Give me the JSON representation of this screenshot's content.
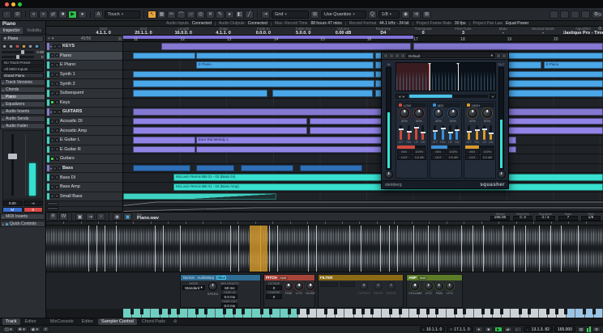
{
  "colors": {
    "accent_green": "#2fbf4e",
    "record_red": "#d84848",
    "tool_highlight": "#e8a33d",
    "clip_blue": "#4aa7e8",
    "clip_blue_dark": "#2f6fb8",
    "clip_purple": "#9184e6",
    "folder_purple": "#8478d2",
    "clip_cyan": "#38e0cf",
    "clip_teal": "#3ed2c2",
    "cycle_purple": "#8071d8",
    "band_low": "#cf4a3c",
    "band_mid": "#3f8fd6",
    "band_high": "#d89a2c",
    "selection_orange": "#d69a28",
    "meter_cyan": "#35e0d0"
  },
  "toolbar": {
    "transport": [
      {
        "icon": "rewind",
        "glyph": "«"
      },
      {
        "icon": "forward",
        "glyph": "»"
      },
      {
        "icon": "cycle",
        "glyph": "⇄"
      },
      {
        "icon": "stop",
        "glyph": "■"
      },
      {
        "icon": "play",
        "glyph": "▶",
        "active": true
      },
      {
        "icon": "record",
        "glyph": "●"
      }
    ],
    "automation_mode": "Touch",
    "tools": [
      {
        "name": "object-selection",
        "glyph": "↖",
        "active": true
      },
      {
        "name": "range",
        "glyph": "▦"
      },
      {
        "name": "split",
        "glyph": "✂"
      },
      {
        "name": "glue",
        "glyph": "⌒"
      },
      {
        "name": "erase",
        "glyph": "▱"
      },
      {
        "name": "zoom",
        "glyph": "◎"
      },
      {
        "name": "mute",
        "glyph": "✕"
      },
      {
        "name": "draw",
        "glyph": "✎"
      },
      {
        "name": "play-tool",
        "glyph": "▸"
      },
      {
        "name": "color",
        "glyph": "◧"
      },
      {
        "name": "line",
        "glyph": "╱"
      }
    ],
    "snap_label": "Grid",
    "quantize_label": "Use Quantize",
    "quantize_value": "1/8"
  },
  "status_line": {
    "items": [
      {
        "label": "Audio Inputs",
        "value": "Connected"
      },
      {
        "label": "Audio Outputs",
        "value": "Connected"
      },
      {
        "label": "Max. Record Time",
        "value": "88 hours 47 mins"
      },
      {
        "label": "Record Format",
        "value": "44.1 kHz - 24 bit"
      },
      {
        "label": "Project Frame Rate",
        "value": "30 fps"
      },
      {
        "label": "Project Pan Law",
        "value": "Equal Power"
      }
    ]
  },
  "info_line": {
    "fields": [
      {
        "label": "Start",
        "value": "4.1.1. 0"
      },
      {
        "label": "End",
        "value": "20.1.1. 0"
      },
      {
        "label": "Length",
        "value": "16.0.0. 0"
      },
      {
        "label": "Snap",
        "value": "4.1.1. 0"
      },
      {
        "label": "Fade-In",
        "value": "0.0.0. 0"
      },
      {
        "label": "Fade-Out",
        "value": "5.0.0. 0"
      },
      {
        "label": "Volume",
        "value": "0.00 dB"
      },
      {
        "label": "Root Key",
        "value": "D4"
      },
      {
        "label": "Transpose",
        "value": "0"
      },
      {
        "label": "Fine-Tune",
        "value": "3"
      },
      {
        "label": "Mute",
        "value": "-"
      },
      {
        "label": "Musical Mode",
        "value": "-"
      },
      {
        "label": "Algorithm",
        "value": "Elastique Pro - Time"
      }
    ]
  },
  "inspector": {
    "track_name": "Piano",
    "tabs": [
      {
        "label": "Inspector",
        "active": true
      },
      {
        "label": "Visibility",
        "active": false
      }
    ],
    "slot_label": "Piano",
    "volume_value": "0.00",
    "pan_value": "C",
    "routing_rows": [
      "No Track Preset",
      "All MIDI Inputs",
      "Grand Piano"
    ],
    "sections": [
      {
        "label": "Track Versions"
      },
      {
        "label": "Chords"
      },
      {
        "label": "Piano",
        "active": true
      },
      {
        "label": "Equalizers"
      },
      {
        "label": "Audio Inserts"
      },
      {
        "label": "Audio Sends"
      },
      {
        "label": "Audio Fader",
        "open": true
      }
    ],
    "fader_value": "0.00",
    "fader_peak": "-∞",
    "mute_label": "M",
    "solo_label": "S",
    "lower_sections": [
      "MIDI Inserts",
      "Quick Controls"
    ]
  },
  "track_list_header": {
    "counter": "45/56"
  },
  "tracks": [
    {
      "name": "KEYS",
      "type": "folder",
      "clips": [
        {
          "l": 8,
          "w": 52,
          "c": "folder"
        },
        {
          "l": 60.5,
          "w": 39.5,
          "c": "folder"
        }
      ]
    },
    {
      "name": "Piano",
      "type": "audio",
      "selected": true,
      "clips": [
        {
          "l": 2,
          "w": 13,
          "c": "blue",
          "tex": "wave"
        },
        {
          "l": 15.2,
          "w": 37,
          "c": "blue",
          "tex": "wave"
        },
        {
          "l": 52.5,
          "w": 24.5,
          "c": "blue",
          "tex": "wave"
        },
        {
          "l": 77.2,
          "w": 22.8,
          "c": "blue",
          "tex": "wave"
        }
      ]
    },
    {
      "name": "E Piano",
      "type": "audio",
      "clips": [
        {
          "l": 15.2,
          "w": 37,
          "c": "blue",
          "tex": "wave",
          "label": "E Piano"
        },
        {
          "l": 52.5,
          "w": 24.5,
          "c": "blue",
          "tex": "wave"
        },
        {
          "l": 77.2,
          "w": 10,
          "c": "blue",
          "tex": "wave"
        },
        {
          "l": 87.6,
          "w": 12.4,
          "c": "blue",
          "tex": "wave",
          "label": "E Piano"
        }
      ]
    },
    {
      "name": "Synth 1",
      "type": "instrument",
      "clips": [
        {
          "l": 2,
          "w": 50.3,
          "c": "blue",
          "tex": "wave"
        },
        {
          "l": 52.5,
          "w": 47.5,
          "c": "blue",
          "tex": "wave"
        }
      ]
    },
    {
      "name": "Synth 2",
      "type": "instrument",
      "clips": [
        {
          "l": 2,
          "w": 50.3,
          "c": "blue",
          "tex": "wave"
        },
        {
          "l": 52.5,
          "w": 47.5,
          "c": "blue",
          "tex": "wave"
        }
      ]
    },
    {
      "name": "Subsequent",
      "type": "instrument",
      "clips": [
        {
          "l": 2,
          "w": 28,
          "c": "blue",
          "tex": "wave"
        },
        {
          "l": 31,
          "w": 21,
          "c": "blue",
          "tex": "wave"
        },
        {
          "l": 52.5,
          "w": 24.5,
          "c": "blue",
          "tex": "wave"
        },
        {
          "l": 77.2,
          "w": 22.8,
          "c": "blue",
          "tex": "wave"
        }
      ]
    },
    {
      "name": "Keys",
      "type": "group",
      "clips": []
    },
    {
      "name": "GUITARS",
      "type": "folder",
      "clips": [
        {
          "l": 2,
          "w": 98,
          "c": "folder"
        }
      ]
    },
    {
      "name": "Acoustic DI",
      "type": "audio",
      "clips": [
        {
          "l": 2,
          "w": 36.3,
          "c": "purple",
          "tex": "wave"
        },
        {
          "l": 38.8,
          "w": 35,
          "c": "purple",
          "tex": "wave"
        },
        {
          "l": 74.2,
          "w": 25.8,
          "c": "purple",
          "tex": "wave"
        }
      ]
    },
    {
      "name": "Acoustic Amp",
      "type": "audio",
      "clips": [
        {
          "l": 2,
          "w": 36.3,
          "c": "purple",
          "tex": "wave"
        },
        {
          "l": 38.8,
          "w": 35,
          "c": "purple",
          "tex": "wave"
        },
        {
          "l": 74.2,
          "w": 25.8,
          "c": "purple",
          "tex": "wave"
        }
      ]
    },
    {
      "name": "E Guitar L",
      "type": "audio",
      "clips": [
        {
          "l": 2,
          "w": 13,
          "c": "purple",
          "tex": "midi"
        },
        {
          "l": 15.2,
          "w": 66.8,
          "c": "purple",
          "tex": "midi",
          "label": "Ever Rid Melody 1"
        }
      ]
    },
    {
      "name": "E Guitar R",
      "type": "audio",
      "clips": [
        {
          "l": 2,
          "w": 13,
          "c": "purple",
          "tex": "midi"
        },
        {
          "l": 15.2,
          "w": 66.8,
          "c": "purple",
          "tex": "midi"
        }
      ]
    },
    {
      "name": "Guitars",
      "type": "group",
      "clips": []
    },
    {
      "name": "Bass",
      "type": "folder",
      "clips": [
        {
          "l": 2,
          "w": 12,
          "c": "blue2"
        },
        {
          "l": 15.2,
          "w": 8,
          "c": "blue2"
        },
        {
          "l": 24.5,
          "w": 11,
          "c": "blue2"
        },
        {
          "l": 36.8,
          "w": 13,
          "c": "blue2"
        }
      ]
    },
    {
      "name": "Bass DI",
      "type": "audio",
      "clips": [
        {
          "l": 10.5,
          "w": 89.5,
          "c": "cyan",
          "tex": "wave",
          "label": "McLovin Remix BB 01 - 02 (Bass DI)"
        }
      ]
    },
    {
      "name": "Bass Amp",
      "type": "audio",
      "clips": [
        {
          "l": 10.5,
          "w": 89.5,
          "c": "cyan",
          "tex": "wave",
          "label": "McLovin Remix BB 01 - 02 (Bass Amp)"
        }
      ]
    },
    {
      "name": "Small Bass",
      "type": "audio",
      "clips": [
        {
          "l": 0,
          "w": 32,
          "c": "teal",
          "tex": "wave",
          "fade": true
        }
      ]
    }
  ],
  "ruler": {
    "bars": [
      {
        "n": "11",
        "p": 2.2
      },
      {
        "n": "12",
        "p": 11.9
      },
      {
        "n": "13",
        "p": 21.6
      },
      {
        "n": "14",
        "p": 31.4
      },
      {
        "n": "15",
        "p": 41.1
      },
      {
        "n": "16",
        "p": 50.8
      },
      {
        "n": "17",
        "p": 60.5
      },
      {
        "n": "18",
        "p": 70.3
      },
      {
        "n": "19",
        "p": 80.0
      },
      {
        "n": "20",
        "p": 89.7
      }
    ],
    "cycle_width_pct": 60.5
  },
  "plugin": {
    "preset": "Default",
    "in_label": "IN",
    "out_label": "OUT",
    "brand": "steinberg",
    "name": "squasher",
    "bands": [
      {
        "name": "LOW",
        "knob1": {
          "label": "UP",
          "value": "40%"
        },
        "knob2": {
          "label": "DOWN",
          "value": "50%"
        },
        "slider_labels": [
          "ATT",
          "REL",
          "UP",
          "DN"
        ],
        "slider_fills": [
          65,
          50,
          78,
          42
        ],
        "bar_pct": 62,
        "rows": [
          {
            "label": "MIX",
            "value": "100%"
          },
          {
            "label": "OUT",
            "value": "0.0 dB"
          }
        ]
      },
      {
        "name": "MID",
        "knob1": {
          "label": "UP",
          "value": "40%"
        },
        "knob2": {
          "label": "DOWN",
          "value": "50%"
        },
        "slider_labels": [
          "ATT",
          "REL",
          "UP",
          "DN"
        ],
        "slider_fills": [
          58,
          70,
          45,
          60
        ],
        "bar_pct": 55,
        "rows": [
          {
            "label": "MIX",
            "value": "100%"
          },
          {
            "label": "OUT",
            "value": "0.0 dB"
          }
        ]
      },
      {
        "name": "HIGH",
        "knob1": {
          "label": "UP",
          "value": "40%"
        },
        "knob2": {
          "label": "DOWN",
          "value": "50%"
        },
        "slider_labels": [
          "ATT",
          "REL",
          "UP",
          "DN"
        ],
        "slider_fills": [
          50,
          62,
          68,
          38
        ],
        "bar_pct": 48,
        "rows": [
          {
            "label": "MIX",
            "value": "100%"
          },
          {
            "label": "OUT",
            "value": "0.0 dB"
          }
        ]
      }
    ]
  },
  "sampler": {
    "file_label": "File",
    "file_name": "Piano.wav",
    "fields": [
      {
        "label": "Tempo",
        "value": "165.00"
      },
      {
        "label": "Root Key",
        "value": "C 3"
      },
      {
        "label": "Signature",
        "value": "4 / 4"
      },
      {
        "label": "Bars",
        "value": "7"
      },
      {
        "label": "Grid",
        "value": "1/8"
      }
    ],
    "warp_lines": [
      7.5,
      9,
      10.5,
      12.5,
      19.5,
      21,
      24,
      33,
      34.5,
      38.5,
      40,
      41.5,
      47,
      48.5,
      54.5,
      56.5,
      60,
      61.5,
      63,
      66,
      68.5,
      70.5,
      74.5,
      76.5,
      78.5,
      82,
      84,
      86,
      88.5,
      90.5,
      92.5,
      95.5
    ],
    "selection": {
      "left_pct": 36.6,
      "width_pct": 3.2
    },
    "playback": {
      "tabs": [
        "Normal",
        "AudioWarp",
        "Slice"
      ],
      "active_tab": 2,
      "mode_label": "MODE",
      "mode_value": "Standard",
      "knob_label": "SPEED",
      "fields": [
        {
          "label": "MIN LENGTH",
          "value": "60 ms"
        },
        {
          "label": "FADE-IN",
          "value": "0.0 ms"
        },
        {
          "label": "FADE-OUT",
          "value": "0.0 ms"
        }
      ]
    },
    "pitch": {
      "title": "PITCH",
      "badge": "mod",
      "fields": [
        {
          "label": "OCTAVE",
          "value": "0"
        },
        {
          "label": "COARSE",
          "value": "0"
        }
      ],
      "knobs": [
        "FINE",
        "LFO",
        "GLIDE"
      ]
    },
    "filter": {
      "title": "FILTER",
      "knobs": [
        "CUTOFF",
        "RESO",
        "DRIVE"
      ]
    },
    "amp": {
      "title": "AMP",
      "badge": "mod",
      "knobs": [
        "VOLUME",
        "LFO",
        "PAN",
        "LFO"
      ]
    },
    "keyboard": {
      "white_keys": 52,
      "teal_to": 19,
      "blue_from": 48
    }
  },
  "bottom": {
    "left_tabs": [
      {
        "label": "Track",
        "active": true
      },
      {
        "label": "Editor",
        "active": false
      }
    ],
    "zone_tabs": [
      {
        "label": "MixConsole",
        "active": false
      },
      {
        "label": "Editor",
        "active": false
      },
      {
        "label": "Sampler Control",
        "active": true
      },
      {
        "label": "Chord Pads",
        "active": false
      }
    ],
    "locator_l": "10.1.1. 0",
    "locator_r": "17.1.1. 0",
    "position": "13.1.3. 82",
    "tempo": "165.000"
  }
}
